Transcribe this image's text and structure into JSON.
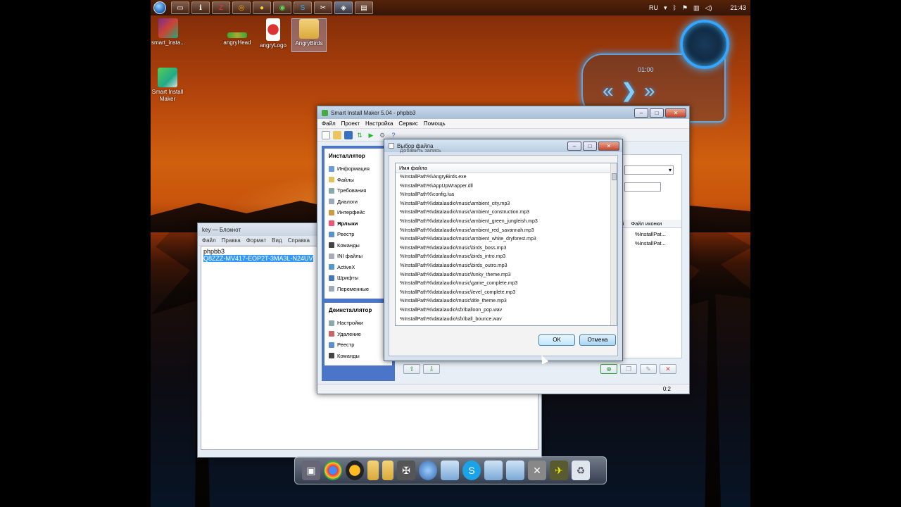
{
  "desktop": {
    "icons": [
      {
        "label": "smart_insta..."
      },
      {
        "label": "angryHead"
      },
      {
        "label": "angryLogo"
      },
      {
        "label": "AngryBirds"
      },
      {
        "label": "Smart Install Maker"
      }
    ]
  },
  "taskbar": {
    "language": "RU",
    "clock": "21:43"
  },
  "gadget": {
    "time": "01:00"
  },
  "notepad": {
    "title": "key — Блокнот",
    "menu": [
      "Файл",
      "Правка",
      "Формат",
      "Вид",
      "Справка"
    ],
    "lines": [
      "phpbb3",
      "Q8ZZZ-MV417-EOP2T-3MA3L-N24UV"
    ]
  },
  "sim": {
    "title": "Smart Install Maker 5.04 - phpbb3",
    "menu": [
      "Файл",
      "Проект",
      "Настройка",
      "Сервис",
      "Помощь"
    ],
    "installer_head": "Инсталлятор",
    "installer_items": [
      "Информация",
      "Файлы",
      "Требования",
      "Диалоги",
      "Интерфейс",
      "Ярлыки",
      "Реестр",
      "Команды",
      "INI файлы",
      "ActiveX",
      "Шрифты",
      "Переменные"
    ],
    "uninstaller_head": "Деинсталлятор",
    "uninstaller_items": [
      "Настройки",
      "Удаление",
      "Реестр",
      "Команды"
    ],
    "right_col_partial": "ай",
    "right_col_header": "Файл иконки",
    "right_rows": [
      "%InstallPat...",
      "%InstallPat..."
    ],
    "status": "0:2"
  },
  "dialog": {
    "title": "Выбор файла",
    "behind_title": "Добавить запись",
    "column": "Имя файла",
    "files": [
      "%InstallPath%\\AngryBirds.exe",
      "%InstallPath%\\AppUpWrapper.dll",
      "%InstallPath%\\config.lua",
      "%InstallPath%\\data\\audio\\music\\ambient_city.mp3",
      "%InstallPath%\\data\\audio\\music\\ambient_construction.mp3",
      "%InstallPath%\\data\\audio\\music\\ambient_green_jungleish.mp3",
      "%InstallPath%\\data\\audio\\music\\ambient_red_savannah.mp3",
      "%InstallPath%\\data\\audio\\music\\ambient_white_dryforest.mp3",
      "%InstallPath%\\data\\audio\\music\\birds_boss.mp3",
      "%InstallPath%\\data\\audio\\music\\birds_intro.mp3",
      "%InstallPath%\\data\\audio\\music\\birds_outro.mp3",
      "%InstallPath%\\data\\audio\\music\\funky_theme.mp3",
      "%InstallPath%\\data\\audio\\music\\game_complete.mp3",
      "%InstallPath%\\data\\audio\\music\\level_complete.mp3",
      "%InstallPath%\\data\\audio\\music\\title_theme.mp3",
      "%InstallPath%\\data\\audio\\sfx\\balloon_pop.wav",
      "%InstallPath%\\data\\audio\\sfx\\ball_bounce.wav"
    ],
    "ok": "OK",
    "cancel": "Отмена"
  }
}
